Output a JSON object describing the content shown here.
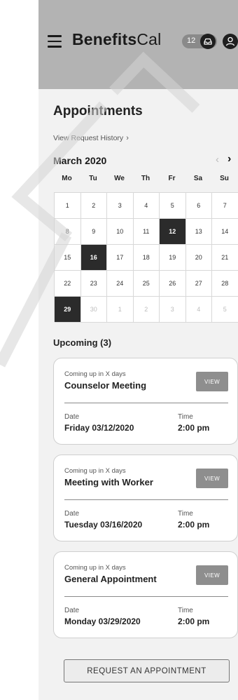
{
  "header": {
    "brand_bold": "Benefits",
    "brand_light": "Cal",
    "notification_count": "12",
    "background_color": "#b3b3b3"
  },
  "appointments": {
    "title": "Appointments",
    "history_link": "View Request History",
    "month_label": "March 2020",
    "weekdays": [
      "Mo",
      "Tu",
      "We",
      "Th",
      "Fr",
      "Sa",
      "Su"
    ],
    "calendar": [
      [
        {
          "d": "1"
        },
        {
          "d": "2"
        },
        {
          "d": "3"
        },
        {
          "d": "4"
        },
        {
          "d": "5"
        },
        {
          "d": "6"
        },
        {
          "d": "7"
        }
      ],
      [
        {
          "d": "8"
        },
        {
          "d": "9"
        },
        {
          "d": "10"
        },
        {
          "d": "11"
        },
        {
          "d": "12",
          "selected": true
        },
        {
          "d": "13"
        },
        {
          "d": "14"
        }
      ],
      [
        {
          "d": "15"
        },
        {
          "d": "16",
          "selected": true
        },
        {
          "d": "17"
        },
        {
          "d": "18"
        },
        {
          "d": "19"
        },
        {
          "d": "20"
        },
        {
          "d": "21"
        }
      ],
      [
        {
          "d": "22"
        },
        {
          "d": "23"
        },
        {
          "d": "24"
        },
        {
          "d": "25"
        },
        {
          "d": "26"
        },
        {
          "d": "27"
        },
        {
          "d": "28"
        }
      ],
      [
        {
          "d": "29",
          "selected": true
        },
        {
          "d": "30",
          "dim": true
        },
        {
          "d": "1",
          "dim": true
        },
        {
          "d": "2",
          "dim": true
        },
        {
          "d": "3",
          "dim": true
        },
        {
          "d": "4",
          "dim": true
        },
        {
          "d": "5",
          "dim": true
        }
      ]
    ]
  },
  "upcoming": {
    "heading": "Upcoming (3)",
    "items": [
      {
        "hint": "Coming up in X days",
        "name": "Counselor Meeting",
        "view_label": "VIEW",
        "date_label": "Date",
        "date": "Friday 03/12/2020",
        "time_label": "Time",
        "time": "2:00 pm"
      },
      {
        "hint": "Coming up in X days",
        "name": "Meeting with Worker",
        "view_label": "VIEW",
        "date_label": "Date",
        "date": "Tuesday 03/16/2020",
        "time_label": "Time",
        "time": "2:00 pm"
      },
      {
        "hint": "Coming up in X days",
        "name": "General Appointment",
        "view_label": "VIEW",
        "date_label": "Date",
        "date": "Monday 03/29/2020",
        "time_label": "Time",
        "time": "2:00 pm"
      }
    ]
  },
  "actions": {
    "request_button": "REQUEST AN APPOINTMENT"
  },
  "icons": {
    "menu": "hamburger-menu-icon",
    "inbox": "inbox-icon",
    "user": "user-icon",
    "prev": "chevron-left-icon",
    "next": "chevron-right-icon"
  }
}
